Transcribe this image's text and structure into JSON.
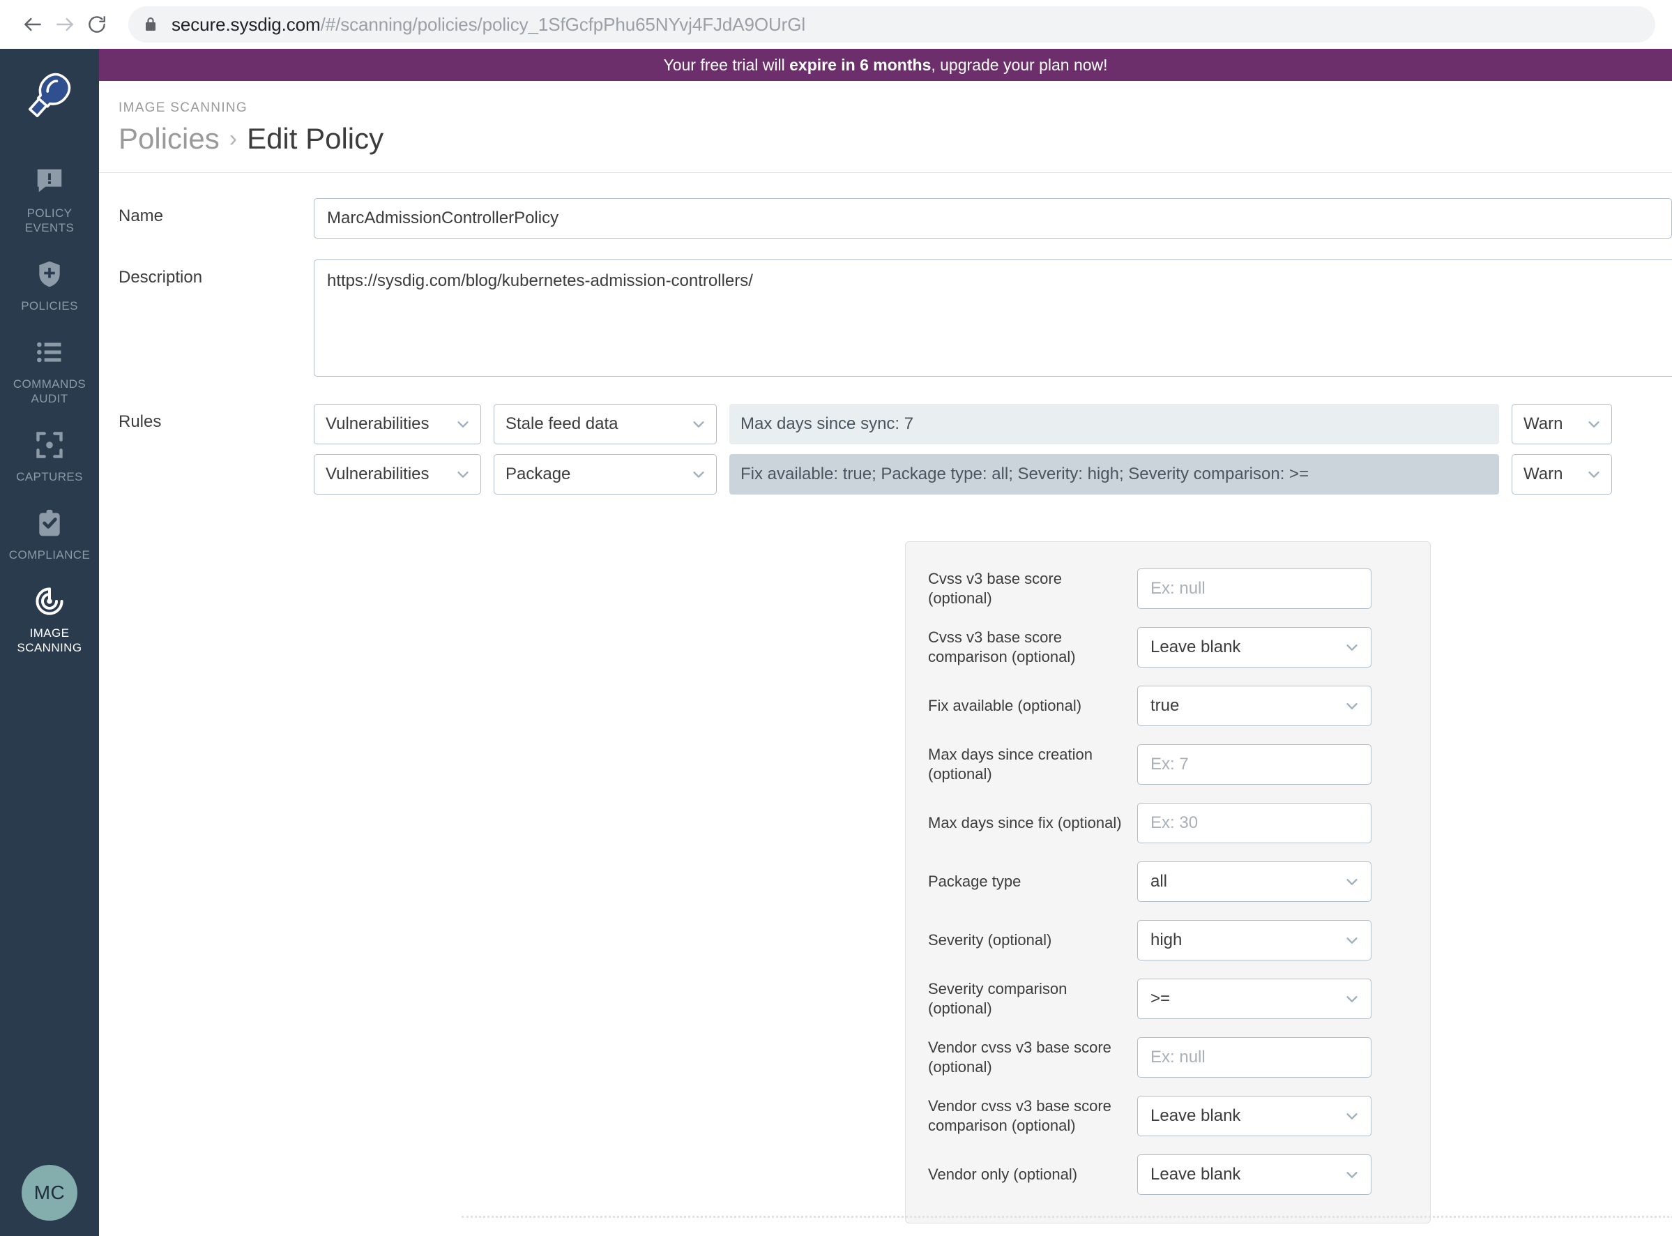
{
  "browser": {
    "back_icon": "arrow-left-icon",
    "forward_icon": "arrow-right-icon",
    "reload_icon": "reload-icon",
    "lock_icon": "lock-icon",
    "url_host": "secure.sysdig.com",
    "url_path": "/#/scanning/policies/policy_1SfGcfpPhu65NYvj4FJdA9OUrGl"
  },
  "sidebar": {
    "logo_name": "sysdig-logo",
    "avatar_initials": "MC",
    "items": [
      {
        "label": "POLICY\nEVENTS",
        "label_line1": "POLICY",
        "label_line2": "EVENTS",
        "icon": "alert-bubble-icon",
        "active": false
      },
      {
        "label": "POLICIES",
        "label_line1": "POLICIES",
        "label_line2": "",
        "icon": "shield-plus-icon",
        "active": false
      },
      {
        "label": "COMMANDS\nAUDIT",
        "label_line1": "COMMANDS",
        "label_line2": "AUDIT",
        "icon": "list-icon",
        "active": false
      },
      {
        "label": "CAPTURES",
        "label_line1": "CAPTURES",
        "label_line2": "",
        "icon": "capture-focus-icon",
        "active": false
      },
      {
        "label": "COMPLIANCE",
        "label_line1": "COMPLIANCE",
        "label_line2": "",
        "icon": "clipboard-check-icon",
        "active": false
      },
      {
        "label": "IMAGE\nSCANNING",
        "label_line1": "IMAGE",
        "label_line2": "SCANNING",
        "icon": "radar-scan-icon",
        "active": true
      }
    ]
  },
  "banner": {
    "text_before": "Your free trial will ",
    "text_bold": "expire in 6 months",
    "text_after": ", upgrade your plan now!",
    "background": "#6d2f6b"
  },
  "header": {
    "eyebrow": "IMAGE SCANNING",
    "breadcrumb_parent": "Policies",
    "breadcrumb_separator": "›",
    "breadcrumb_current": "Edit Policy"
  },
  "form": {
    "name_label": "Name",
    "name_value": "MarcAdmissionControllerPolicy",
    "name_placeholder": "",
    "description_label": "Description",
    "description_value": "https://sysdig.com/blog/kubernetes-admission-controllers/",
    "description_placeholder": "",
    "rules_label": "Rules"
  },
  "rules": [
    {
      "type": "Vulnerabilities",
      "subtype": "Stale feed data",
      "summary": "Max days since sync: 7",
      "action": "Warn",
      "selected": false
    },
    {
      "type": "Vulnerabilities",
      "subtype": "Package",
      "summary": "Fix available: true; Package type: all; Severity: high; Severity comparison: >=",
      "action": "Warn",
      "selected": true
    }
  ],
  "detail_panel": {
    "fields": [
      {
        "label": "Cvss v3 base score (optional)",
        "kind": "input",
        "value": "",
        "placeholder": "Ex: null",
        "name": "cvss-v3-base-score"
      },
      {
        "label": "Cvss v3 base score comparison (optional)",
        "kind": "select",
        "value": "Leave blank",
        "placeholder": "",
        "name": "cvss-v3-base-score-comparison"
      },
      {
        "label": "Fix available (optional)",
        "kind": "select",
        "value": "true",
        "placeholder": "",
        "name": "fix-available"
      },
      {
        "label": "Max days since creation (optional)",
        "kind": "input",
        "value": "",
        "placeholder": "Ex: 7",
        "name": "max-days-since-creation"
      },
      {
        "label": "Max days since fix (optional)",
        "kind": "input",
        "value": "",
        "placeholder": "Ex: 30",
        "name": "max-days-since-fix"
      },
      {
        "label": "Package type",
        "kind": "select",
        "value": "all",
        "placeholder": "",
        "name": "package-type"
      },
      {
        "label": "Severity (optional)",
        "kind": "select",
        "value": "high",
        "placeholder": "",
        "name": "severity"
      },
      {
        "label": "Severity comparison (optional)",
        "kind": "select",
        "value": ">=",
        "placeholder": "",
        "name": "severity-comparison"
      },
      {
        "label": "Vendor cvss v3 base score (optional)",
        "kind": "input",
        "value": "",
        "placeholder": "Ex: null",
        "name": "vendor-cvss-v3-base-score"
      },
      {
        "label": "Vendor cvss v3 base score comparison (optional)",
        "kind": "select",
        "value": "Leave blank",
        "placeholder": "",
        "name": "vendor-cvss-v3-base-score-comparison"
      },
      {
        "label": "Vendor only (optional)",
        "kind": "select",
        "value": "Leave blank",
        "placeholder": "",
        "name": "vendor-only"
      }
    ]
  },
  "colors": {
    "sidebar_bg": "#2a3b4d",
    "banner_purple": "#6d2f6b",
    "control_border": "#b0bec9",
    "rule_summary_bg": "#e9eef1",
    "rule_summary_selected_bg": "#ccd4db",
    "panel_bg": "#f5f5f5",
    "avatar_bg": "#84adad"
  }
}
